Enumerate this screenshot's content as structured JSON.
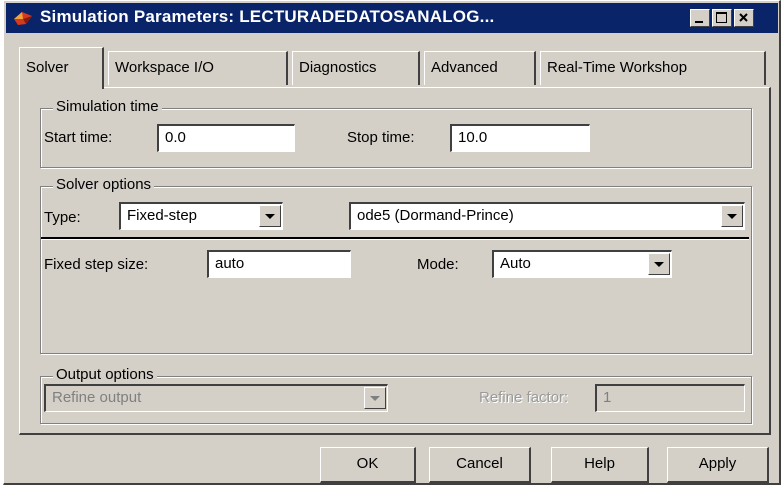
{
  "window": {
    "title": "Simulation Parameters: LECTURADEDATOSANALOG..."
  },
  "tabs": [
    {
      "label": "Solver"
    },
    {
      "label": "Workspace I/O"
    },
    {
      "label": "Diagnostics"
    },
    {
      "label": "Advanced"
    },
    {
      "label": "Real-Time Workshop"
    }
  ],
  "simulation_time": {
    "title": "Simulation time",
    "start_label": "Start time:",
    "start_value": "0.0",
    "stop_label": "Stop time:",
    "stop_value": "10.0"
  },
  "solver_options": {
    "title": "Solver options",
    "type_label": "Type:",
    "type_value": "Fixed-step",
    "solver_value": "ode5 (Dormand-Prince)",
    "step_label": "Fixed step size:",
    "step_value": "auto",
    "mode_label": "Mode:",
    "mode_value": "Auto"
  },
  "output_options": {
    "title": "Output options",
    "refine_select": "Refine output",
    "refine_factor_label": "Refine factor:",
    "refine_factor_value": "1"
  },
  "buttons": {
    "ok": "OK",
    "cancel": "Cancel",
    "help": "Help",
    "apply": "Apply"
  },
  "icons": {
    "app": "simulink-icon",
    "minimize": "minimize-icon",
    "maximize": "maximize-icon",
    "close": "close-icon",
    "dropdown": "chevron-down-icon"
  },
  "colors": {
    "titlebar": "#0a246a",
    "face": "#d4d0c8"
  }
}
